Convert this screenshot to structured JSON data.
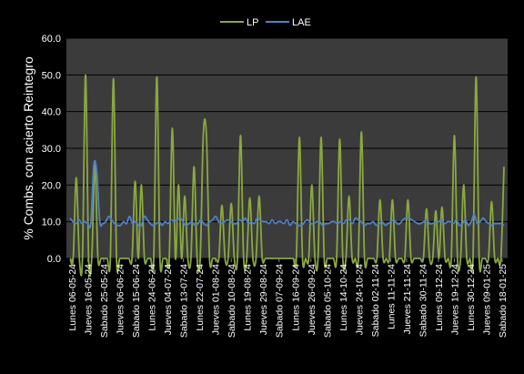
{
  "chart_data": {
    "type": "line",
    "title": "",
    "xlabel": "",
    "ylabel": "% Combs. con acierto Reintegro",
    "ylim": [
      0,
      60
    ],
    "yticks": [
      "0.0",
      "10.0",
      "20.0",
      "30.0",
      "40.0",
      "50.0",
      "60.0"
    ],
    "grid": true,
    "legend_position": "top",
    "colors": {
      "background": "#000000",
      "plot_area": "#3b3b3b",
      "grid": "#000000",
      "text": "#ffffff"
    },
    "x_labels": [
      "Lunes 06-05-24",
      "Jueves 16-05-24",
      "Sabado 25-05-24",
      "Jueves 06-06-24",
      "Sabado 15-06-24",
      "Lunes 24-06-24",
      "Jueves 04-07-24",
      "Sabado 13-07-24",
      "Lunes 22-07-24",
      "Jueves 01-08-24",
      "Sabado 10-08-24",
      "Lunes 19-08-24",
      "Jueves 29-08-24",
      "Sabado 07-09-24",
      "Lunes 16-09-24",
      "Jueves 26-09-24",
      "Sabado 05-10-24",
      "Lunes 14-10-24",
      "Jueves 24-10-24",
      "Sabado 02-11-24",
      "Lunes 11-11-24",
      "Jueves 21-11-24",
      "Sabado 30-11-24",
      "Lunes 09-12-24",
      "Jueves 19-12-24",
      "Lunes 30-12-24",
      "Jueves 09-01-25",
      "Sabado 18-01-25"
    ],
    "series": [
      {
        "name": "LP",
        "color": "#8aa840",
        "values": [
          0,
          0,
          22,
          0,
          0,
          50,
          0,
          0,
          25.5,
          0,
          0,
          0,
          0,
          0,
          49,
          0,
          0,
          0,
          0,
          0,
          0,
          21,
          0,
          20,
          0,
          0,
          0,
          0,
          49.5,
          0,
          0,
          0,
          0,
          35.5,
          0,
          20,
          0,
          17,
          0,
          0,
          25,
          0,
          0,
          34,
          33.5,
          0,
          0,
          0,
          0,
          14.5,
          0,
          0,
          15,
          0,
          0,
          33.5,
          0,
          0,
          16.5,
          0,
          0,
          17,
          0,
          0,
          0,
          0,
          0,
          0,
          0,
          0,
          0,
          0,
          0,
          0,
          33,
          0,
          0,
          0,
          20,
          0,
          0,
          33,
          0,
          0,
          0,
          0,
          0,
          32.5,
          0,
          0,
          17,
          0,
          0,
          0,
          34.5,
          0,
          0,
          0,
          0,
          0,
          16,
          0,
          0,
          0,
          16,
          0,
          0,
          0,
          0,
          16,
          0,
          0,
          0,
          0,
          0,
          13.5,
          0,
          0,
          13,
          0,
          14,
          0,
          0,
          0,
          33.5,
          0,
          0,
          20,
          0,
          0,
          0,
          49.5,
          0,
          0,
          0,
          0,
          15.5,
          0,
          0,
          0,
          25
        ]
      },
      {
        "name": "LAE",
        "color": "#4f81c7",
        "values": [
          11,
          10,
          9.5,
          10.5,
          9.5,
          10,
          9.5,
          9.5,
          25.5,
          23.5,
          10,
          9.5,
          10,
          11.5,
          10.5,
          9.5,
          9,
          9,
          10,
          9.5,
          11.5,
          9.5,
          10,
          9,
          9,
          11.5,
          10.5,
          9.5,
          9,
          9.5,
          10,
          9,
          10,
          9.5,
          10.5,
          10,
          10.5,
          11,
          10,
          9,
          9.5,
          10,
          9,
          9.5,
          10.5,
          9.5,
          9,
          10,
          10.5,
          11.5,
          10,
          9.5,
          10,
          10.5,
          10,
          9.5,
          9.5,
          10.5,
          10,
          11,
          9.5,
          10,
          9.5,
          11,
          10.5,
          10,
          10,
          9.5,
          10.5,
          9.5,
          10,
          10,
          9.5,
          10.5,
          9,
          10,
          9.5,
          9,
          9,
          10,
          10.5,
          9.5,
          9.5,
          10,
          10,
          9,
          9.5,
          9.5,
          10,
          10,
          9.5,
          10,
          9.5,
          10.5,
          10.5,
          9.5,
          11,
          10.5,
          10,
          9,
          9.5,
          9.5,
          10,
          9,
          9.5,
          10,
          9,
          9.5,
          10,
          10.5,
          9.5,
          9.5,
          10.5,
          11,
          11,
          10.5,
          10,
          9.5,
          9.5,
          10,
          10.5,
          9.5,
          9.5,
          10,
          10,
          10.5,
          9.5,
          10,
          10,
          9.5,
          10.5,
          9,
          9.5,
          10.5,
          9,
          10,
          12,
          9.5,
          10,
          11,
          10,
          9.5,
          9,
          9.5,
          9.5,
          9.5,
          9
        ]
      }
    ]
  }
}
